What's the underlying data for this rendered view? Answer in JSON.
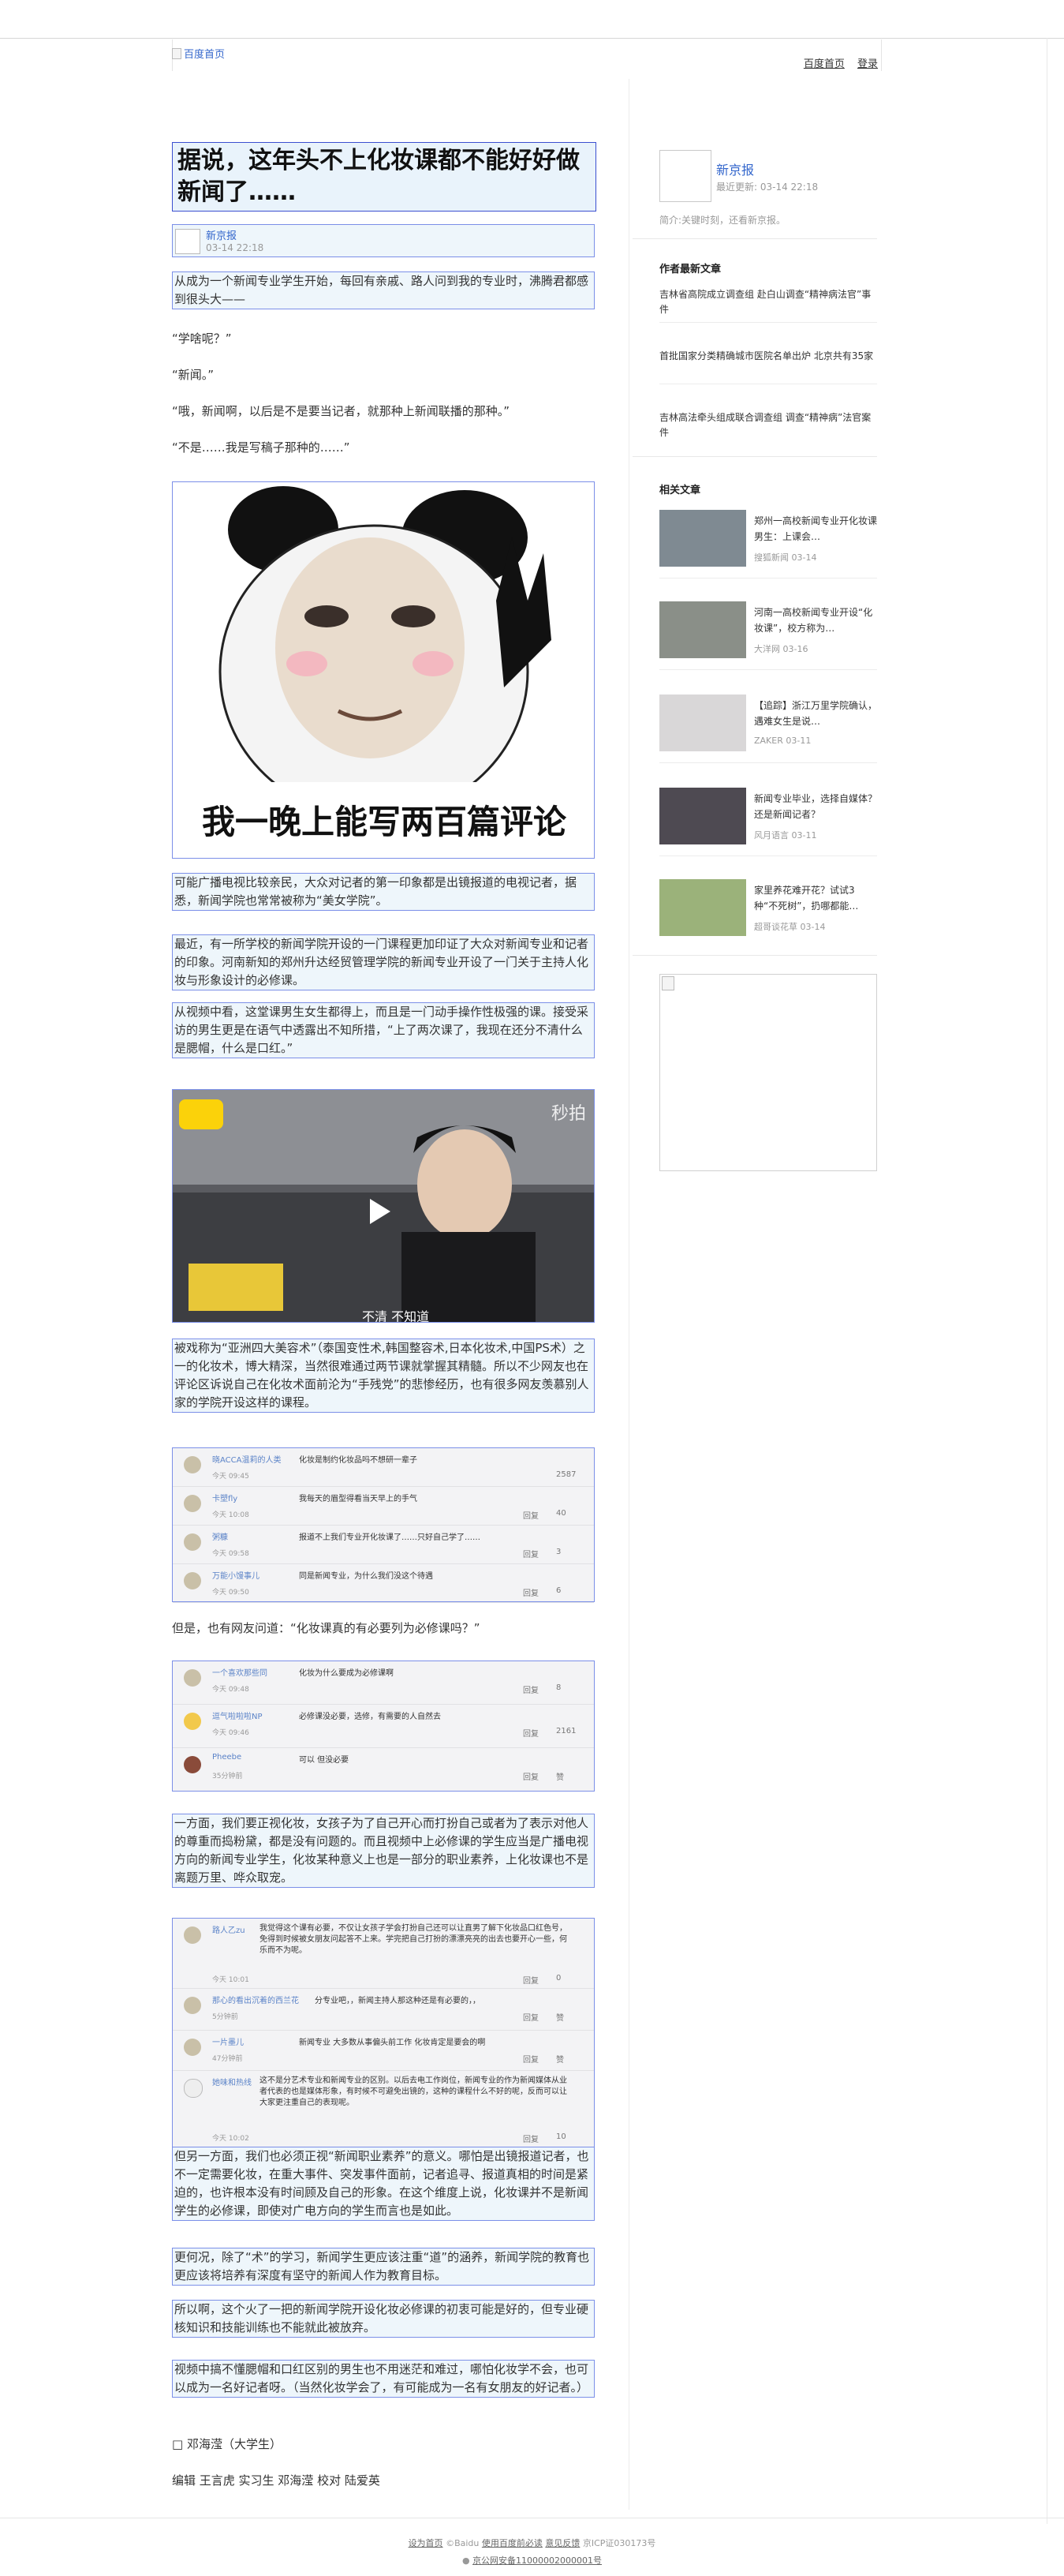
{
  "header": {
    "logo_alt": "百度首页",
    "nav": [
      "百度首页",
      "登录"
    ]
  },
  "article": {
    "title": "据说，这年头不上化妆课都不能好好做新闻了……",
    "author_name": "新京报",
    "author_time": "03-14 22:18",
    "paragraphs": [
      "从成为一个新闻专业学生开始，每回有亲戚、路人问到我的专业时，沸腾君都感到很头大——",
      "“学啥呢？”",
      "“新闻。”",
      "“哦，新闻啊，以后是不是要当记者，就那种上新闻联播的那种。”",
      "“不是……我是写稿子那种的……”"
    ],
    "meme_caption": "我一晚上能写两百篇评论",
    "p2": "可能广播电视比较亲民，大众对记者的第一印象都是出镜报道的电视记者，据悉，新闻学院也常常被称为“美女学院”。",
    "p3": "最近，有一所学校的新闻学院开设的一门课程更加印证了大众对新闻专业和记者的印象。河南新知的郑州升达经贸管理学院的新闻专业开设了一门关于主持人化妆与形象设计的必修课。",
    "p4": "从视频中看，这堂课男生女生都得上，而且是一门动手操作性极强的课。接受采访的男生更是在语气中透露出不知所措，“上了两次课了，我现在还分不清什么是腮帽，什么是口红。”",
    "video_watermark": "秒拍",
    "video_subtitle": "不清 不知道",
    "p5": "被戏称为“亚洲四大美容术”（泰国变性术,韩国整容术,日本化妆术,中国PS术）之一的化妆术，博大精深，当然很难通过两节课就掌握其精髓。所以不少网友也在评论区诉说自己在化妆术面前沦为“手残党”的悲惨经历，也有很多网友羡慕别人家的学院开设这样的课程。",
    "comments1": [
      {
        "name": "晓ACCA温莉的人类",
        "text": "化妆是制约化妆品吗不想研一辈子",
        "time": "今天 09:45",
        "reply": "",
        "likes": "2587"
      },
      {
        "name": "卡塑fly",
        "text": "我每天的眉型得看当天早上的手气",
        "time": "今天 10:08",
        "reply": "回复",
        "likes": "40"
      },
      {
        "name": "粥糠",
        "text": "报道不上我们专业开化妆课了……只好自己学了……",
        "time": "今天 09:58",
        "reply": "回复",
        "likes": "3"
      },
      {
        "name": "万能小馒事儿",
        "text": "同是新闻专业，为什么我们没这个待遇",
        "time": "今天 09:50",
        "reply": "回复",
        "likes": "6"
      }
    ],
    "p6": "但是，也有网友问道：“化妆课真的有必要列为必修课吗？”",
    "comments2": [
      {
        "name": "一个喜欢那些同",
        "text": "化妆为什么要成为必修课啊",
        "time": "今天 09:48",
        "reply": "回复",
        "likes": "8"
      },
      {
        "name": "逗气啦啦啦NP",
        "text": "必修课没必要，选修，有需要的人自然去",
        "time": "今天 09:46",
        "reply": "回复",
        "likes": "2161"
      },
      {
        "name": "Pheebe",
        "text": "可以 但没必要",
        "time": "35分钟前",
        "reply": "回复",
        "likes": "赞"
      }
    ],
    "p7": "一方面，我们要正视化妆，女孩子为了自己开心而打扮自己或者为了表示对他人的尊重而捣粉黛，都是没有问题的。而且视频中上必修课的学生应当是广播电视方向的新闻专业学生，化妆某种意义上也是一部分的职业素养，上化妆课也不是离题万里、哗众取宠。",
    "comments3": [
      {
        "name": "路人乙zu",
        "text": "我觉得这个课有必要，不仅让女孩子学会打扮自己还可以让直男了解下化妆品口红色号，免得到时候被女朋友问起答不上来。学完把自己打扮的漂漂亮亮的出去也要开心一些，何乐而不为呢。",
        "time": "今天 10:01",
        "reply": "回复",
        "likes": "0"
      },
      {
        "name": "那心的看出沉着的西兰花",
        "text": "分专业吧，，新闻主持人那这种还是有必要的，，",
        "time": "5分钟前",
        "reply": "回复",
        "likes": "赞"
      },
      {
        "name": "一片墨儿",
        "text": "新闻专业 大多数从事偏头前工作 化妆肯定是要会的啊",
        "time": "47分钟前",
        "reply": "回复",
        "likes": "赞"
      },
      {
        "name": "她味和热线",
        "text": "这不是分艺术专业和新闻专业的区别。以后去电工作岗位，新闻专业的作为新闻媒体从业者代表的也是媒体形象，有时候不可避免出镜的，这种的课程什么不好的呢，反而可以让大家更注重自己的表现呢。",
        "time": "今天 10:02",
        "reply": "回复",
        "likes": "10"
      }
    ],
    "p8": "但另一方面，我们也必须正视“新闻职业素养”的意义。哪怕是出镜报道记者，也不一定需要化妆，在重大事件、突发事件面前，记者追寻、报道真相的时间是紧迫的，也许根本没有时间顾及自己的形象。在这个维度上说，化妆课并不是新闻学生的必修课，即使对广电方向的学生而言也是如此。",
    "p9": "更何况，除了“术”的学习，新闻学生更应该注重“道”的涵养，新闻学院的教育也更应该将培养有深度有坚守的新闻人作为教育目标。",
    "p10": "所以啊，这个火了一把的新闻学院开设化妆必修课的初衷可能是好的，但专业硬核知识和技能训练也不能就此被放弃。",
    "p11": "视频中搞不懂腮帽和口红区别的男生也不用迷茫和难过，哪怕化妆学不会，也可以成为一名好记者呀。（当然化妆学会了，有可能成为一名有女朋友的好记者。）",
    "byline": "□ 邓海滢（大学生）",
    "editor": "编辑 王言虎 实习生 邓海滢 校对 陆爱英"
  },
  "sidebar": {
    "name": "新京报",
    "updated": "最近更新: 03-14 22:18",
    "desc": "简介:关键时刻，还看新京报。",
    "latest_head": "作者最新文章",
    "latest": [
      "吉林省高院成立调查组 赴白山调查“精神病法官”事件",
      "首批国家分类精确城市医院名单出炉 北京共有35家",
      "吉林高法牵头组成联合调查组 调查“精神病”法官案件"
    ],
    "related_head": "相关文章",
    "related": [
      {
        "title": "郑州一高校新闻专业开化妆课 男生：上课会…",
        "source": "搜狐新闻",
        "date": "03-14"
      },
      {
        "title": "河南一高校新闻专业开设“化妆课”，校方称为…",
        "source": "大洋网",
        "date": "03-16"
      },
      {
        "title": "【追踪】浙江万里学院确认，遇难女生是说…",
        "source": "ZAKER",
        "date": "03-11"
      },
      {
        "title": "新闻专业毕业，选择自媒体？还是新闻记者？",
        "source": "风月语言",
        "date": "03-11"
      },
      {
        "title": "家里养花难开花？试试3种“不死树”，扔哪都能…",
        "source": "超哥谈花草",
        "date": "03-14"
      }
    ]
  },
  "footer": {
    "links": [
      "设为首页",
      "使用百度前必读",
      "意见反馈"
    ],
    "copyright": "©Baidu",
    "icp": "京ICP证030173号",
    "beian": "京公网安备11000002000001号"
  },
  "colors": {
    "link": "#3366cc",
    "highlight_box": "#7b8fe8",
    "highlight_bg": "#eef6fb"
  }
}
